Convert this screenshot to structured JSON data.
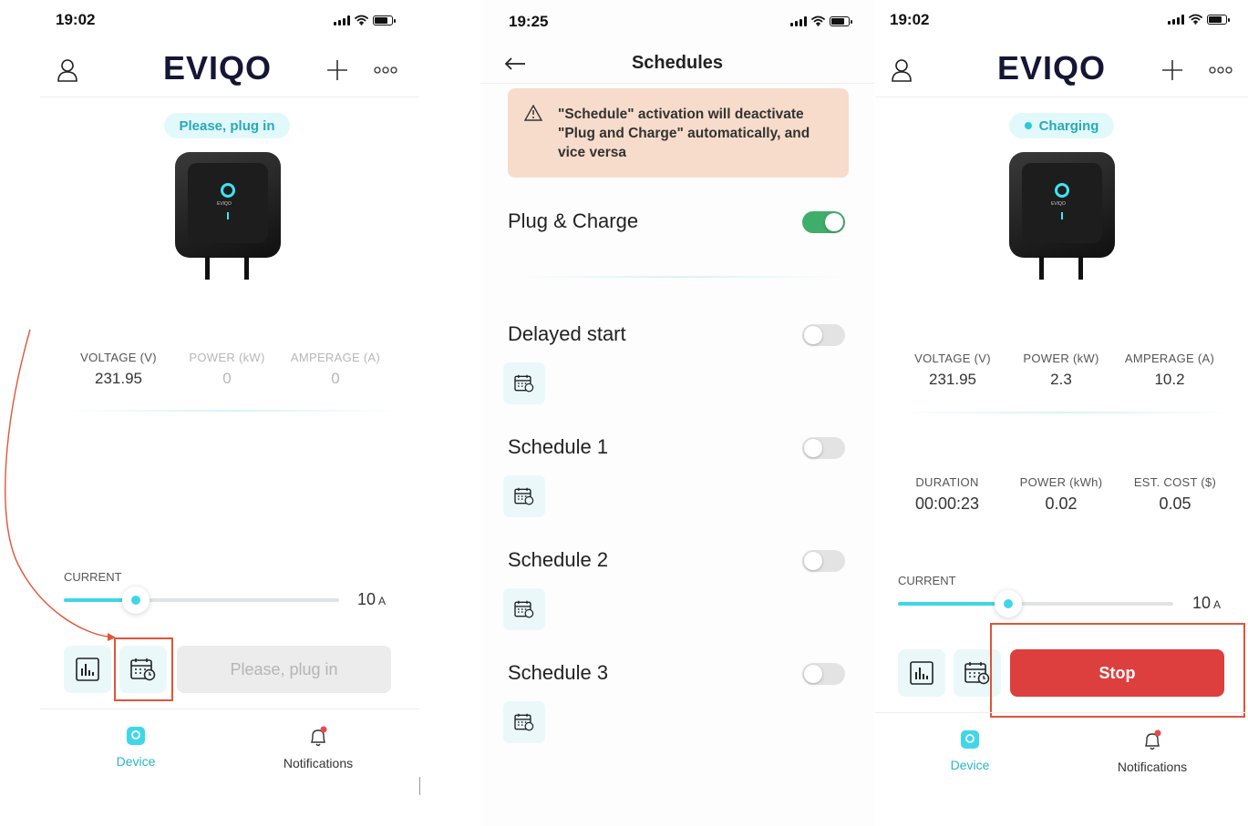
{
  "screen1": {
    "time": "19:02",
    "logo": "EVIQO",
    "status_pill": "Please, plug in",
    "device_brand": "EVIQO",
    "metrics": [
      {
        "label": "VOLTAGE (V)",
        "value": "231.95"
      },
      {
        "label": "POWER (kW)",
        "value": "0"
      },
      {
        "label": "AMPERAGE (A)",
        "value": "0"
      }
    ],
    "current_label": "CURRENT",
    "current_value": "10",
    "current_unit": "A",
    "current_level": 0.26,
    "action_button": "Please, plug in",
    "nav": {
      "device": "Device",
      "notifications": "Notifications"
    }
  },
  "screen2": {
    "time": "19:25",
    "title": "Schedules",
    "warning": "\"Schedule\" activation will deactivate \"Plug and Charge\" automatically, and vice versa",
    "rows": [
      {
        "label": "Plug & Charge",
        "on": true
      },
      {
        "label": "Delayed start",
        "on": false
      },
      {
        "label": "Schedule 1",
        "on": false
      },
      {
        "label": "Schedule 2",
        "on": false
      },
      {
        "label": "Schedule 3",
        "on": false
      }
    ]
  },
  "screen3": {
    "time": "19:02",
    "logo": "EVIQO",
    "status_pill": "Charging",
    "device_brand": "EVIQO",
    "metrics": [
      {
        "label": "VOLTAGE (V)",
        "value": "231.95"
      },
      {
        "label": "POWER (kW)",
        "value": "2.3"
      },
      {
        "label": "AMPERAGE (A)",
        "value": "10.2"
      }
    ],
    "session": [
      {
        "label": "DURATION",
        "value": "00:00:23"
      },
      {
        "label": "POWER (kWh)",
        "value": "0.02"
      },
      {
        "label": "EST. COST ($)",
        "value": "0.05"
      }
    ],
    "current_label": "CURRENT",
    "current_value": "10",
    "current_unit": "A",
    "current_level": 0.4,
    "action_button": "Stop",
    "nav": {
      "device": "Device",
      "notifications": "Notifications"
    }
  },
  "colors": {
    "accent": "#3fd7e8",
    "stop": "#dc3f3d",
    "toggle_on": "#3fae6b",
    "annotation": "#e0553a"
  }
}
